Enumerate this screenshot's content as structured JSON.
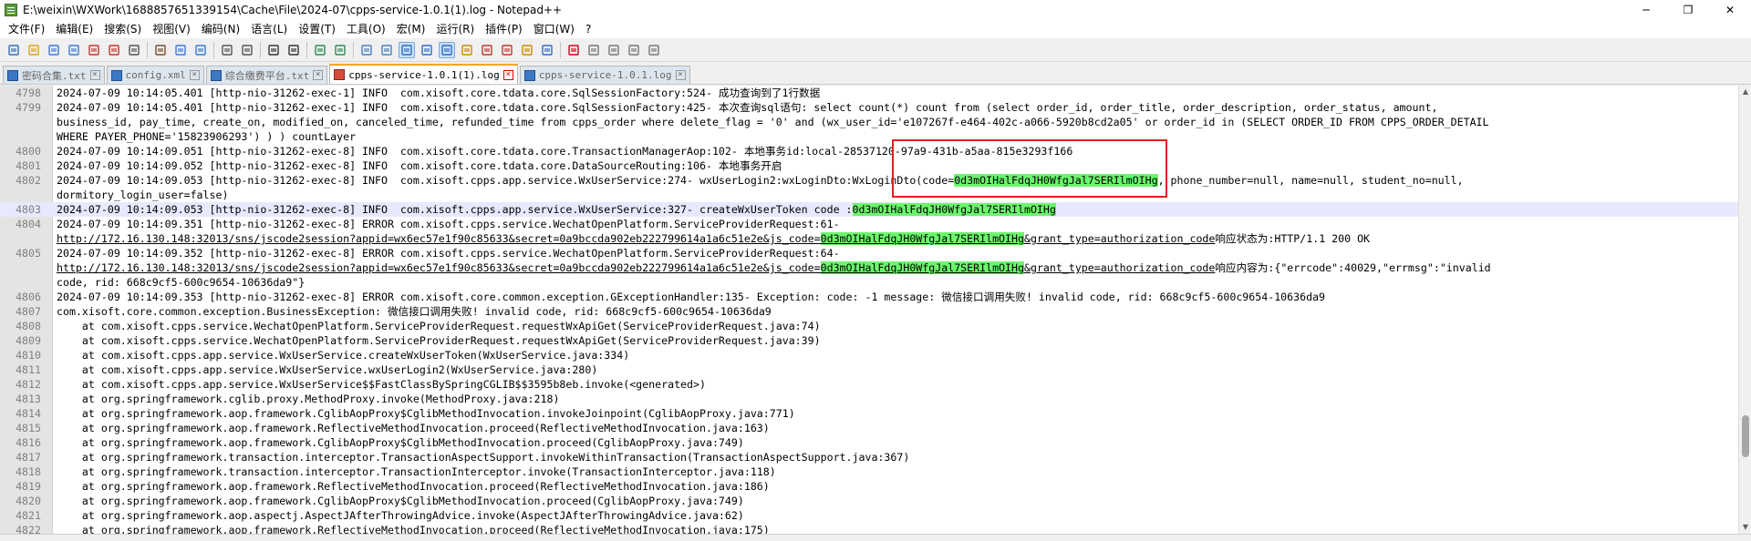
{
  "window": {
    "title": "E:\\weixin\\WXWork\\1688857651339154\\Cache\\File\\2024-07\\cpps-service-1.0.1(1).log - Notepad++",
    "minimize": "─",
    "maximize": "❐",
    "close": "✕"
  },
  "menu": [
    "文件(F)",
    "编辑(E)",
    "搜索(S)",
    "视图(V)",
    "编码(N)",
    "语言(L)",
    "设置(T)",
    "工具(O)",
    "宏(M)",
    "运行(R)",
    "插件(P)",
    "窗口(W)",
    "?"
  ],
  "tabs": [
    {
      "label": "密码合集.txt",
      "active": false
    },
    {
      "label": "config.xml",
      "active": false
    },
    {
      "label": "综合缴费平台.txt",
      "active": false
    },
    {
      "label": "cpps-service-1.0.1(1).log",
      "active": true
    },
    {
      "label": "cpps-service-1.0.1.log",
      "active": false
    }
  ],
  "toolbar_icons": [
    "new-file-icon",
    "open-file-icon",
    "save-icon",
    "save-all-icon",
    "close-icon",
    "close-all-icon",
    "print-icon",
    "cut-icon",
    "copy-icon",
    "paste-icon",
    "undo-icon",
    "redo-icon",
    "find-icon",
    "replace-icon",
    "zoom-in-icon",
    "zoom-out-icon",
    "sync-vertical-icon",
    "sync-horizontal-icon",
    "word-wrap-icon",
    "show-all-chars-icon",
    "indent-guide-icon",
    "udl-icon",
    "doc-map-icon",
    "function-list-icon",
    "folder-workspace-icon",
    "monitoring-icon",
    "record-macro-icon",
    "stop-macro-icon",
    "play-macro-icon",
    "run-macro-multiple-icon",
    "save-macro-icon"
  ],
  "lines": [
    {
      "n": "4798",
      "t": "2024-07-09 10:14:05.401 [http-nio-31262-exec-1] INFO  com.xisoft.core.tdata.core.SqlSessionFactory:524- 成功查询到了1行数据"
    },
    {
      "n": "4799",
      "t": "2024-07-09 10:14:05.401 [http-nio-31262-exec-1] INFO  com.xisoft.core.tdata.core.SqlSessionFactory:425- 本次查询sql语句: select count(*) count from (select order_id, order_title, order_description, order_status, amount,"
    },
    {
      "n": "",
      "t": "business_id, pay_time, create_on, modified_on, canceled_time, refunded_time from cpps_order where delete_flag = '0' and (wx_user_id='e107267f-e464-402c-a066-5920b8cd2a05' or order_id in (SELECT ORDER_ID FROM CPPS_ORDER_DETAIL"
    },
    {
      "n": "",
      "t": "WHERE PAYER_PHONE='15823906293') ) ) countLayer"
    },
    {
      "n": "4800",
      "t": "2024-07-09 10:14:09.051 [http-nio-31262-exec-8] INFO  com.xisoft.core.tdata.core.TransactionManagerAop:102- 本地事务id:local-28537120-97a9-431b-a5aa-815e3293f166"
    },
    {
      "n": "4801",
      "t": "2024-07-09 10:14:09.052 [http-nio-31262-exec-8] INFO  com.xisoft.core.tdata.core.DataSourceRouting:106- 本地事务开启"
    },
    {
      "n": "4802",
      "t1": "2024-07-09 10:14:09.053 [http-nio-31262-exec-8] INFO  com.xisoft.cpps.app.service.WxUserService:274- wxUserLogin2:wxLoginDto:WxLoginDto(code=",
      "h": "0d3mOIHalFdqJH0WfgJal7SERIlmOIHg",
      "t2": ", phone_number=null, name=null, student_no=null,"
    },
    {
      "n": "",
      "t": "dormitory_login_user=false)"
    },
    {
      "n": "4803",
      "cur": true,
      "t1": "2024-07-09 10:14:09.053 [http-nio-31262-exec-8] INFO  com.xisoft.cpps.app.service.WxUserService:327- createWxUserToken code :",
      "h": "0d3mOIHalFdqJH0WfgJal7SERIlmOIHg",
      "t2": ""
    },
    {
      "n": "4804",
      "t": "2024-07-09 10:14:09.351 [http-nio-31262-exec-8] ERROR com.xisoft.cpps.service.WechatOpenPlatform.ServiceProviderRequest:61-"
    },
    {
      "n": "",
      "u1": "http://172.16.130.148:32013/sns/jscode2session?appid=wx6ec57e1f90c85633&secret=0a9bccda902eb222799614a1a6c51e2e&js_code=",
      "h": "0d3mOIHalFdqJH0WfgJal7SERIlmOIHg",
      "u2": "&grant_type=authorization_code",
      "t2": "响应状态为:HTTP/1.1 200 OK"
    },
    {
      "n": "4805",
      "t": "2024-07-09 10:14:09.352 [http-nio-31262-exec-8] ERROR com.xisoft.cpps.service.WechatOpenPlatform.ServiceProviderRequest:64-"
    },
    {
      "n": "",
      "u1": "http://172.16.130.148:32013/sns/jscode2session?appid=wx6ec57e1f90c85633&secret=0a9bccda902eb222799614a1a6c51e2e&js_code=",
      "h": "0d3mOIHalFdqJH0WfgJal7SERIlmOIHg",
      "u2": "&grant_type=authorization_code",
      "t2": "响应内容为:{\"errcode\":40029,\"errmsg\":\"invalid"
    },
    {
      "n": "",
      "t": "code, rid: 668c9cf5-600c9654-10636da9\"}"
    },
    {
      "n": "4806",
      "t": "2024-07-09 10:14:09.353 [http-nio-31262-exec-8] ERROR com.xisoft.core.common.exception.GExceptionHandler:135- Exception: code: -1 message: 微信接口调用失败! invalid code, rid: 668c9cf5-600c9654-10636da9"
    },
    {
      "n": "4807",
      "t": "com.xisoft.core.common.exception.BusinessException: 微信接口调用失败! invalid code, rid: 668c9cf5-600c9654-10636da9"
    },
    {
      "n": "4808",
      "t": "    at com.xisoft.cpps.service.WechatOpenPlatform.ServiceProviderRequest.requestWxApiGet(ServiceProviderRequest.java:74)"
    },
    {
      "n": "4809",
      "t": "    at com.xisoft.cpps.service.WechatOpenPlatform.ServiceProviderRequest.requestWxApiGet(ServiceProviderRequest.java:39)"
    },
    {
      "n": "4810",
      "t": "    at com.xisoft.cpps.app.service.WxUserService.createWxUserToken(WxUserService.java:334)"
    },
    {
      "n": "4811",
      "t": "    at com.xisoft.cpps.app.service.WxUserService.wxUserLogin2(WxUserService.java:280)"
    },
    {
      "n": "4812",
      "t": "    at com.xisoft.cpps.app.service.WxUserService$$FastClassBySpringCGLIB$$3595b8eb.invoke(<generated>)"
    },
    {
      "n": "4813",
      "t": "    at org.springframework.cglib.proxy.MethodProxy.invoke(MethodProxy.java:218)"
    },
    {
      "n": "4814",
      "t": "    at org.springframework.aop.framework.CglibAopProxy$CglibMethodInvocation.invokeJoinpoint(CglibAopProxy.java:771)"
    },
    {
      "n": "4815",
      "t": "    at org.springframework.aop.framework.ReflectiveMethodInvocation.proceed(ReflectiveMethodInvocation.java:163)"
    },
    {
      "n": "4816",
      "t": "    at org.springframework.aop.framework.CglibAopProxy$CglibMethodInvocation.proceed(CglibAopProxy.java:749)"
    },
    {
      "n": "4817",
      "t": "    at org.springframework.transaction.interceptor.TransactionAspectSupport.invokeWithinTransaction(TransactionAspectSupport.java:367)"
    },
    {
      "n": "4818",
      "t": "    at org.springframework.transaction.interceptor.TransactionInterceptor.invoke(TransactionInterceptor.java:118)"
    },
    {
      "n": "4819",
      "t": "    at org.springframework.aop.framework.ReflectiveMethodInvocation.proceed(ReflectiveMethodInvocation.java:186)"
    },
    {
      "n": "4820",
      "t": "    at org.springframework.aop.framework.CglibAopProxy$CglibMethodInvocation.proceed(CglibAopProxy.java:749)"
    },
    {
      "n": "4821",
      "t": "    at org.springframework.aop.aspectj.AspectJAfterThrowingAdvice.invoke(AspectJAfterThrowingAdvice.java:62)"
    },
    {
      "n": "4822",
      "t": "    at org.springframework.aop.framework.ReflectiveMethodInvocation.proceed(ReflectiveMethodInvocation.java:175)"
    }
  ],
  "colors": {
    "highlight": "#6cf56c",
    "current_line": "#e8e8ff",
    "annotation": "#e0201b",
    "active_tab_accent": "#f5a623"
  }
}
